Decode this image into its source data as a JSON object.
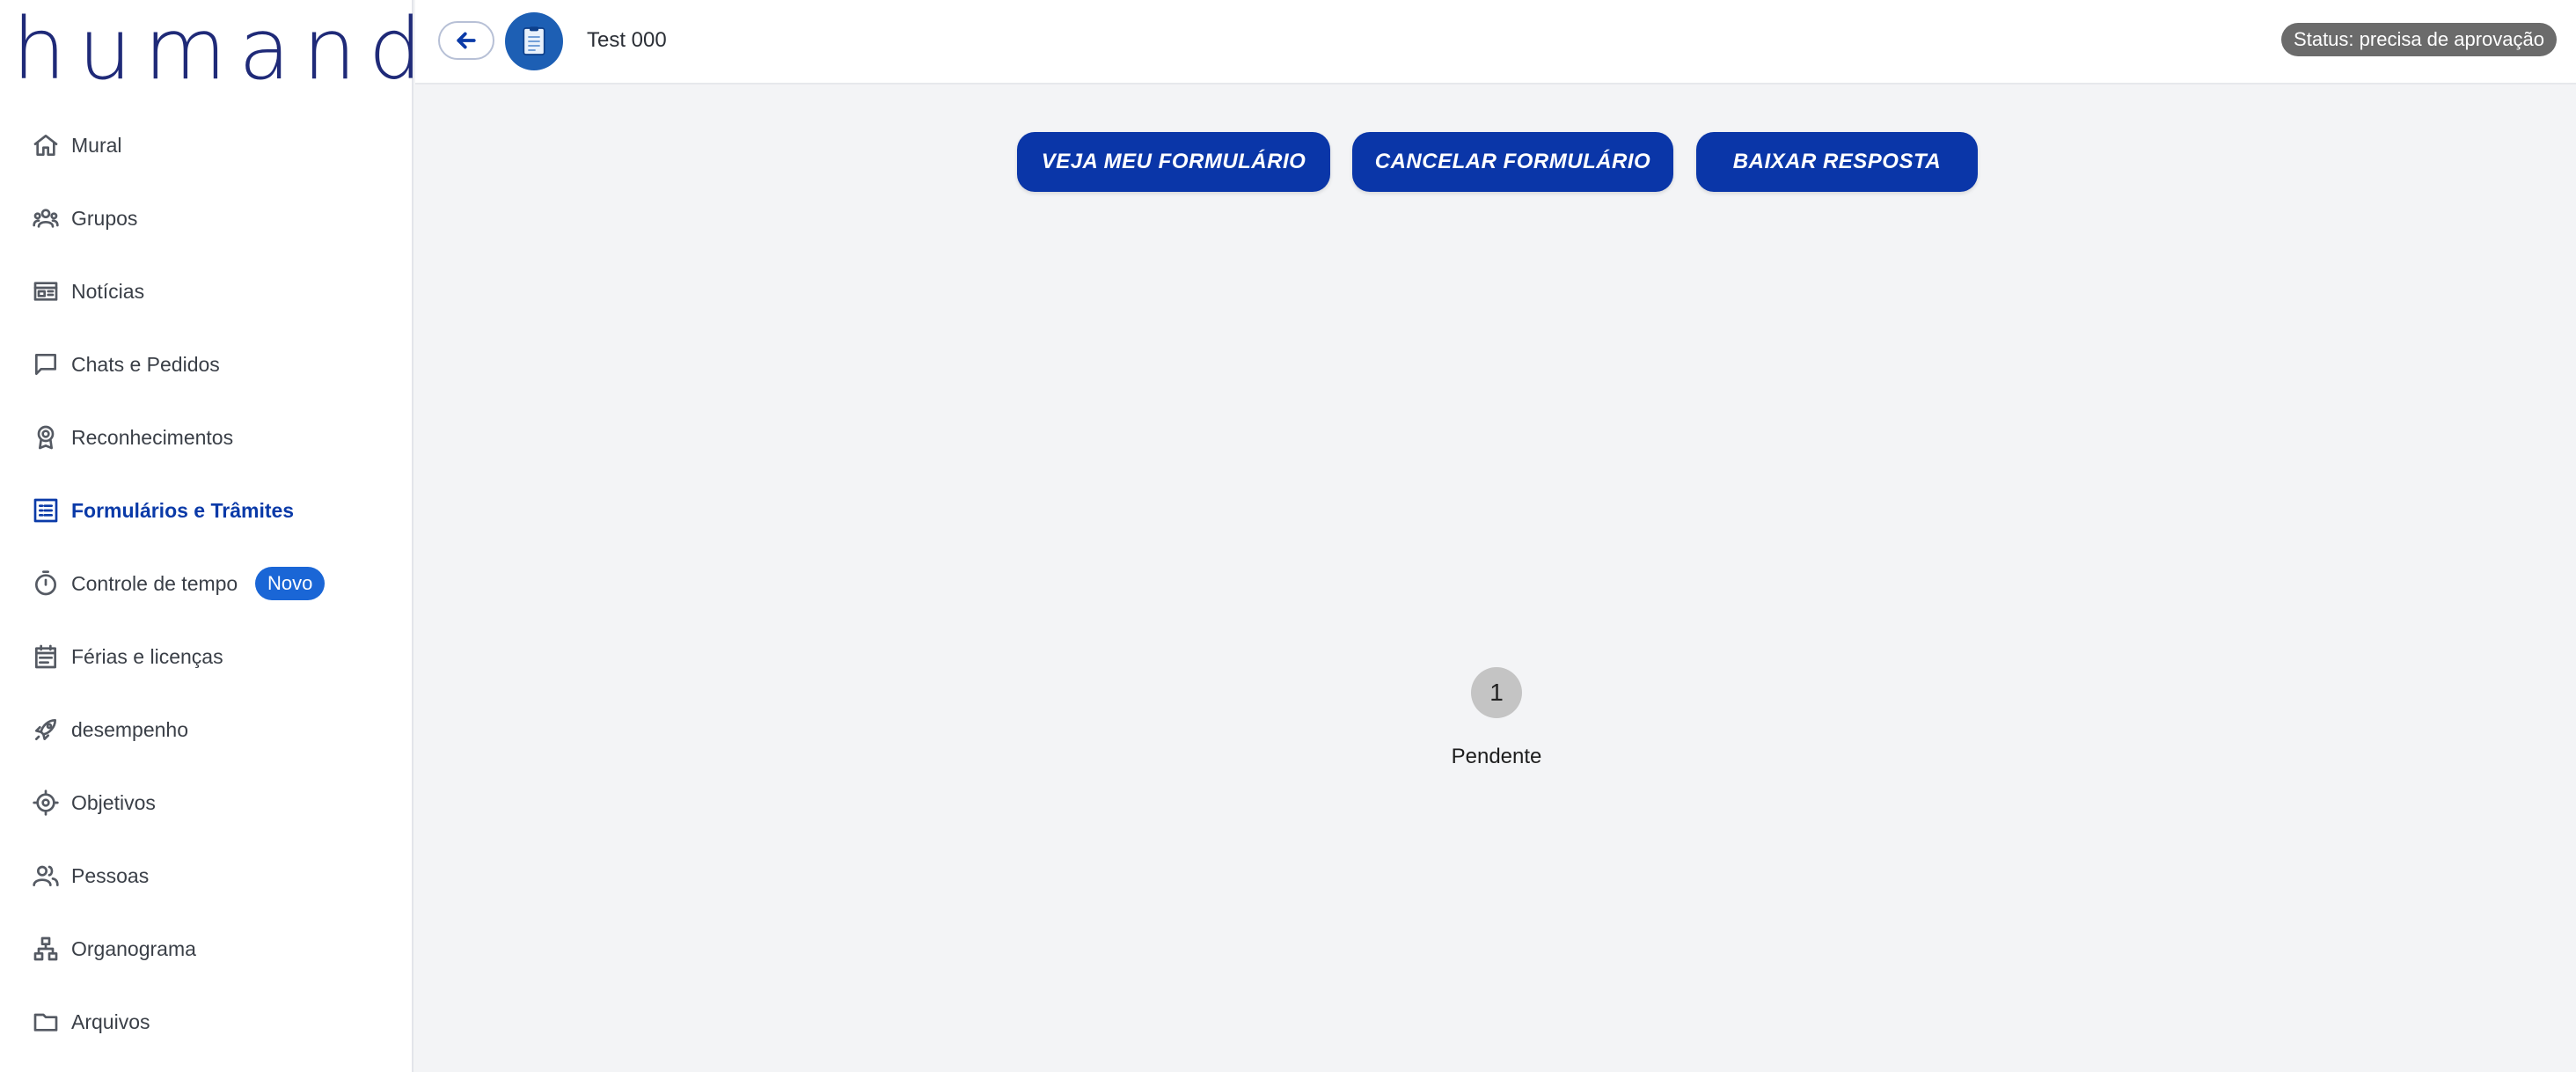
{
  "sidebar": {
    "logo": "humand",
    "items": [
      {
        "label": "Mural",
        "icon": "home-icon"
      },
      {
        "label": "Grupos",
        "icon": "groups-icon"
      },
      {
        "label": "Notícias",
        "icon": "news-icon"
      },
      {
        "label": "Chats e Pedidos",
        "icon": "chat-icon"
      },
      {
        "label": "Reconhecimentos",
        "icon": "award-icon"
      },
      {
        "label": "Formulários e Trâmites",
        "icon": "form-list-icon",
        "active": true
      },
      {
        "label": "Controle de tempo",
        "icon": "timer-icon",
        "badge": "Novo"
      },
      {
        "label": "Férias e licenças",
        "icon": "calendar-icon"
      },
      {
        "label": "desempenho",
        "icon": "rocket-icon"
      },
      {
        "label": "Objetivos",
        "icon": "target-icon"
      },
      {
        "label": "Pessoas",
        "icon": "people-icon"
      },
      {
        "label": "Organograma",
        "icon": "org-chart-icon"
      },
      {
        "label": "Arquivos",
        "icon": "folder-icon"
      }
    ]
  },
  "header": {
    "title": "Test 000",
    "status": "Status: precisa de aprovação"
  },
  "actions": {
    "view_form": "VEJA MEU FORMULÁRIO",
    "cancel_form": "CANCELAR FORMULÁRIO",
    "download_response": "BAIXAR RESPOSTA"
  },
  "step": {
    "number": "1",
    "label": "Pendente"
  },
  "colors": {
    "primary": "#0a36a8",
    "logo": "#1f2a78",
    "badge": "#1a66d6",
    "status_badge": "#6b6b6b",
    "step_circle": "#c4c4c4",
    "background": "#f3f4f6"
  }
}
